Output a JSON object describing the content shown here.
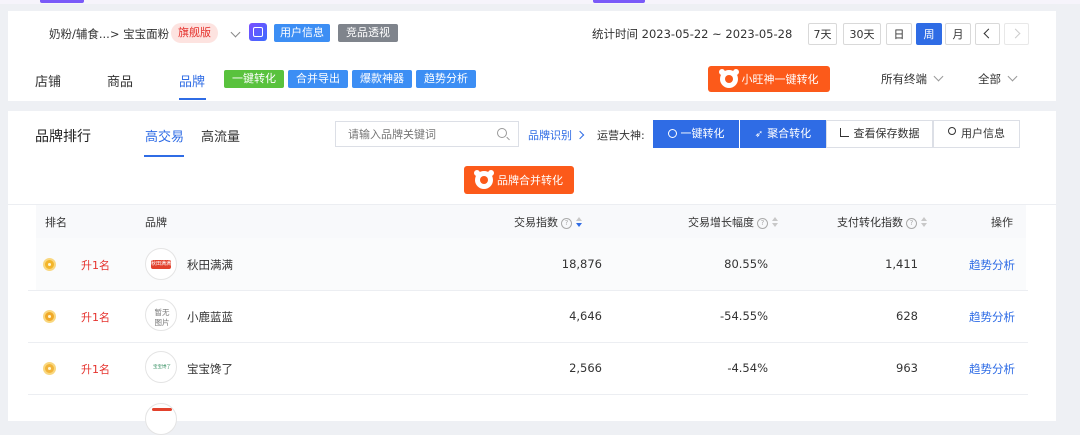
{
  "header": {
    "category_path": "奶粉/辅食...> 宝宝面粉",
    "edition_badge": "旗舰版",
    "user_info_btn": "用户信息",
    "competitor_btn": "竞品透视",
    "stats_time_label": "统计时间",
    "stats_range": "2023-05-22 ~ 2023-05-28",
    "range_buttons": [
      "7天",
      "30天",
      "日",
      "周",
      "月"
    ],
    "active_range": "周"
  },
  "nav": {
    "tabs": [
      "店铺",
      "商品",
      "品牌"
    ],
    "active_tab": "品牌",
    "action_buttons": [
      "一键转化",
      "合并导出",
      "爆款神器",
      "趋势分析"
    ],
    "xiaowang_btn": "小旺神一键转化",
    "terminal_select": "所有终端",
    "all_select": "全部"
  },
  "ranking": {
    "title": "品牌排行",
    "tabs": [
      "高交易",
      "高流量"
    ],
    "active_tab": "高交易",
    "search_placeholder": "请输入品牌关键词",
    "brand_identify_link": "品牌识别",
    "ops_label": "运营大神:",
    "tools": [
      "一键转化",
      "聚合转化",
      "查看保存数据",
      "用户信息"
    ],
    "merge_btn": "品牌合并转化"
  },
  "table": {
    "headers": [
      "排名",
      "品牌",
      "交易指数",
      "交易增长幅度",
      "支付转化指数",
      "操作"
    ],
    "rows": [
      {
        "change": "升1名",
        "brand": "秋田满满",
        "logo_text": "秋田满满",
        "trade": "18,876",
        "growth": "80.55%",
        "conv": "1,411",
        "action": "趋势分析"
      },
      {
        "change": "升1名",
        "brand": "小鹿蓝蓝",
        "logo_text": "暂无图片",
        "trade": "4,646",
        "growth": "-54.55%",
        "conv": "628",
        "action": "趋势分析"
      },
      {
        "change": "升1名",
        "brand": "宝宝馋了",
        "logo_text": "宝宝馋了",
        "trade": "2,566",
        "growth": "-4.54%",
        "conv": "963",
        "action": "趋势分析"
      }
    ]
  },
  "colors": {
    "primary": "#2f6ce5",
    "orange": "#fc5a1a",
    "green": "#59c23d",
    "rank_red": "#e5322d"
  }
}
